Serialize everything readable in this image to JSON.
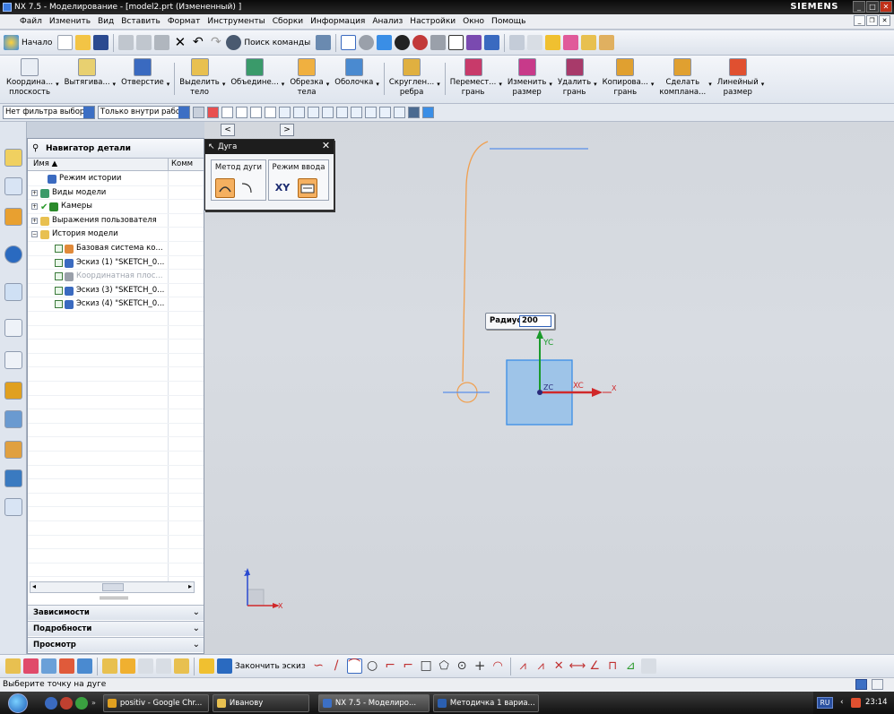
{
  "window": {
    "title": "NX 7.5 - Моделирование - [model2.prt (Измененный) ]",
    "brand": "SIEMENS"
  },
  "menu": [
    "Файл",
    "Изменить",
    "Вид",
    "Вставить",
    "Формат",
    "Инструменты",
    "Сборки",
    "Информация",
    "Анализ",
    "Настройки",
    "Окно",
    "Помощь"
  ],
  "toolbar1": {
    "start_label": "Начало",
    "find_command_label": "Поиск команды"
  },
  "toolbar2": [
    {
      "label": "Координа...\nплоскость",
      "icon": "datum-plane-icon"
    },
    {
      "label": "Вытягива...",
      "icon": "extrude-icon"
    },
    {
      "label": "Отверстие",
      "icon": "hole-icon"
    },
    {
      "label": "Выделить\nтело",
      "icon": "extract-body-icon"
    },
    {
      "label": "Объедине...",
      "icon": "unite-icon"
    },
    {
      "label": "Обрезка\nтела",
      "icon": "trim-body-icon"
    },
    {
      "label": "Оболочка",
      "icon": "shell-icon"
    },
    {
      "label": "Скруглен...\nребра",
      "icon": "edge-blend-icon"
    },
    {
      "label": "Перемест...\nгрань",
      "icon": "move-face-icon"
    },
    {
      "label": "Изменить\nразмер",
      "icon": "resize-face-icon"
    },
    {
      "label": "Удалить\nгрань",
      "icon": "delete-face-icon"
    },
    {
      "label": "Копирова...\nгрань",
      "icon": "copy-face-icon"
    },
    {
      "label": "Сделать\nкомплана...",
      "icon": "make-coplanar-icon"
    },
    {
      "label": "Линейный\nразмер",
      "icon": "linear-dimension-icon"
    }
  ],
  "selection": {
    "filter": "Нет фильтра выбор",
    "scope": "Только внутри рабо"
  },
  "navigator": {
    "title": "Навигатор детали",
    "col_name": "Имя",
    "col_comment": "Комм",
    "rows": [
      {
        "label": "Режим истории",
        "indent": 1,
        "state": "normal"
      },
      {
        "label": "Виды модели",
        "indent": 0,
        "state": "normal"
      },
      {
        "label": "Камеры",
        "indent": 0,
        "state": "normal"
      },
      {
        "label": "Выражения пользователя",
        "indent": 0,
        "state": "normal"
      },
      {
        "label": "История модели",
        "indent": 0,
        "state": "normal"
      },
      {
        "label": "Базовая система ко...",
        "indent": 2,
        "state": "normal"
      },
      {
        "label": "Эскиз (1) \"SKETCH_0...",
        "indent": 2,
        "state": "normal"
      },
      {
        "label": "Координатная плос...",
        "indent": 2,
        "state": "disabled"
      },
      {
        "label": "Эскиз (3) \"SKETCH_0...",
        "indent": 2,
        "state": "normal"
      },
      {
        "label": "Эскиз (4) \"SKETCH_0...",
        "indent": 2,
        "state": "normal"
      }
    ],
    "panels": [
      "Зависимости",
      "Подробности",
      "Просмотр"
    ]
  },
  "arc_dialog": {
    "title": "Дуга",
    "method_label": "Метод дуги",
    "input_mode_label": "Режим ввода",
    "xy_label": "XY"
  },
  "radius": {
    "label": "Радиус",
    "value": "200"
  },
  "axes": {
    "yc": "YC",
    "xc": "XC",
    "zc": "ZC",
    "x": "X",
    "z": "Z"
  },
  "sketch_toolbar": {
    "finish_label": "Закончить эскиз"
  },
  "status": "Выберите точку на дуге",
  "taskbar": {
    "tasks": [
      {
        "label": "positiv - Google Chr...",
        "color": "#e0a020"
      },
      {
        "label": "Иванову",
        "color": "#e8c050"
      },
      {
        "label": "NX 7.5 - Моделиро...",
        "color": "#3c6fc4"
      },
      {
        "label": "Методичка 1 вариа...",
        "color": "#2b5fb0"
      }
    ],
    "lang": "RU",
    "time": "23:14"
  },
  "colors": {
    "accent": "#3c6fc4",
    "sketch_orange": "#f0a050",
    "grid_blue": "#5a8ee8",
    "axis_green": "#1a9a2a",
    "axis_red": "#d0282a",
    "square_fill": "#9ec4e8"
  }
}
